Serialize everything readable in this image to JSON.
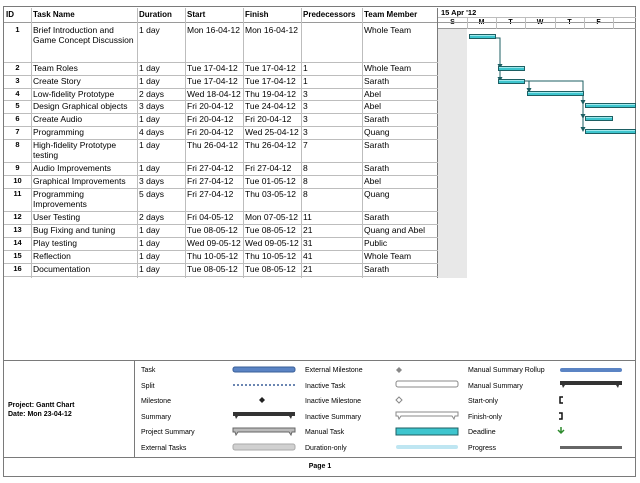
{
  "headers": {
    "id": "ID",
    "task_name": "Task Name",
    "duration": "Duration",
    "start": "Start",
    "finish": "Finish",
    "predecessors": "Predecessors",
    "team_member": "Team Member"
  },
  "timescale": {
    "week_label": "15 Apr '12",
    "days": [
      "S",
      "M",
      "T",
      "W",
      "T",
      "F"
    ]
  },
  "tasks": [
    {
      "id": "1",
      "name": "Brief Introduction and Game Concept Discussion",
      "duration": "1 day",
      "start": "Mon 16-04-12",
      "finish": "Mon 16-04-12",
      "pred": "",
      "member": "Whole Team"
    },
    {
      "id": "2",
      "name": "Team Roles",
      "duration": "1 day",
      "start": "Tue 17-04-12",
      "finish": "Tue 17-04-12",
      "pred": "1",
      "member": "Whole Team"
    },
    {
      "id": "3",
      "name": "Create Story",
      "duration": "1 day",
      "start": "Tue 17-04-12",
      "finish": "Tue 17-04-12",
      "pred": "1",
      "member": "Sarath"
    },
    {
      "id": "4",
      "name": "Low-fidelity Prototype",
      "duration": "2 days",
      "start": "Wed 18-04-12",
      "finish": "Thu 19-04-12",
      "pred": "3",
      "member": "Abel"
    },
    {
      "id": "5",
      "name": "Design Graphical objects",
      "duration": "3 days",
      "start": "Fri 20-04-12",
      "finish": "Tue 24-04-12",
      "pred": "3",
      "member": "Abel"
    },
    {
      "id": "6",
      "name": "Create Audio",
      "duration": "1 day",
      "start": "Fri 20-04-12",
      "finish": "Fri 20-04-12",
      "pred": "3",
      "member": "Sarath"
    },
    {
      "id": "7",
      "name": "Programming",
      "duration": "4 days",
      "start": "Fri 20-04-12",
      "finish": "Wed 25-04-12",
      "pred": "3",
      "member": "Quang"
    },
    {
      "id": "8",
      "name": "High-fidelity Prototype testing",
      "duration": "1 day",
      "start": "Thu 26-04-12",
      "finish": "Thu 26-04-12",
      "pred": "7",
      "member": "Sarath"
    },
    {
      "id": "9",
      "name": "Audio Improvements",
      "duration": "1 day",
      "start": "Fri 27-04-12",
      "finish": "Fri 27-04-12",
      "pred": "8",
      "member": "Sarath"
    },
    {
      "id": "10",
      "name": "Graphical Improvements",
      "duration": "3 days",
      "start": "Fri 27-04-12",
      "finish": "Tue 01-05-12",
      "pred": "8",
      "member": "Abel"
    },
    {
      "id": "11",
      "name": "Programming Improvements",
      "duration": "5 days",
      "start": "Fri 27-04-12",
      "finish": "Thu 03-05-12",
      "pred": "8",
      "member": "Quang"
    },
    {
      "id": "12",
      "name": "User Testing",
      "duration": "2 days",
      "start": "Fri 04-05-12",
      "finish": "Mon 07-05-12",
      "pred": "11",
      "member": "Sarath"
    },
    {
      "id": "13",
      "name": "Bug Fixing and tuning",
      "duration": "1 day",
      "start": "Tue 08-05-12",
      "finish": "Tue 08-05-12",
      "pred": "21",
      "member": "Quang and Abel"
    },
    {
      "id": "14",
      "name": "Play testing",
      "duration": "1 day",
      "start": "Wed 09-05-12",
      "finish": "Wed 09-05-12",
      "pred": "31",
      "member": "Public"
    },
    {
      "id": "15",
      "name": "Reflection",
      "duration": "1 day",
      "start": "Thu 10-05-12",
      "finish": "Thu 10-05-12",
      "pred": "41",
      "member": "Whole Team"
    },
    {
      "id": "16",
      "name": "Documentation",
      "duration": "1 day",
      "start": "Tue 08-05-12",
      "finish": "Tue 08-05-12",
      "pred": "21",
      "member": "Sarath"
    }
  ],
  "legend": {
    "project_label": "Project: Gantt Chart",
    "date_label": "Date: Mon 23-04-12",
    "col1": [
      "Task",
      "Split",
      "Milestone",
      "Summary",
      "Project Summary",
      "External Tasks"
    ],
    "col2": [
      "External Milestone",
      "Inactive Task",
      "Inactive Milestone",
      "Inactive Summary",
      "Manual Task",
      "Duration-only"
    ],
    "col3": [
      "Manual Summary Rollup",
      "Manual Summary",
      "Start-only",
      "Finish-only",
      "Deadline",
      "Progress"
    ]
  },
  "footer": {
    "page": "Page 1"
  },
  "colors": {
    "bar": "#3ec5ce",
    "bar_border": "#1d5f63",
    "weekend": "#e8e8e8",
    "task_legend": "#5b84c4"
  }
}
